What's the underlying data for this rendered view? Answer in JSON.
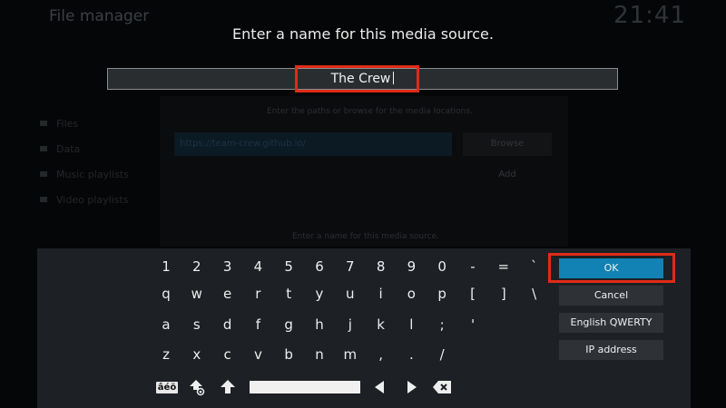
{
  "window": {
    "title": "File manager",
    "clock": "21:41"
  },
  "background": {
    "sidebar": [
      "Files",
      "Data",
      "Music playlists",
      "Video playlists"
    ],
    "dialog_hint": "Enter the paths or browse for the media locations.",
    "url_value": "https://team-crew.github.io/",
    "browse_label": "Browse",
    "add_label": "Add",
    "footer_hint": "Enter a name for this media source."
  },
  "dialog": {
    "heading": "Enter a name for this media source.",
    "input_value": "The Crew"
  },
  "keyboard": {
    "row1": [
      "1",
      "2",
      "3",
      "4",
      "5",
      "6",
      "7",
      "8",
      "9",
      "0",
      "-",
      "=",
      "`"
    ],
    "row2": [
      "q",
      "w",
      "e",
      "r",
      "t",
      "y",
      "u",
      "i",
      "o",
      "p",
      "[",
      "]",
      "\\"
    ],
    "row3": [
      "a",
      "s",
      "d",
      "f",
      "g",
      "h",
      "j",
      "k",
      "l",
      ";",
      "'"
    ],
    "row4": [
      "z",
      "x",
      "c",
      "v",
      "b",
      "n",
      "m",
      ",",
      ".",
      "/"
    ],
    "symbols_label": "âéö",
    "buttons": {
      "ok": "OK",
      "cancel": "Cancel",
      "layout": "English QWERTY",
      "ip": "IP address"
    }
  },
  "colors": {
    "accent": "#1182b3",
    "highlight": "#e02b18",
    "keyboard_bg": "#1d2024"
  },
  "icons": {
    "symbols": "accent-chars-icon",
    "caps_lock": "caps-lock-icon",
    "shift": "shift-arrow-icon",
    "left": "arrow-left-icon",
    "right": "arrow-right-icon",
    "backspace": "backspace-icon"
  }
}
